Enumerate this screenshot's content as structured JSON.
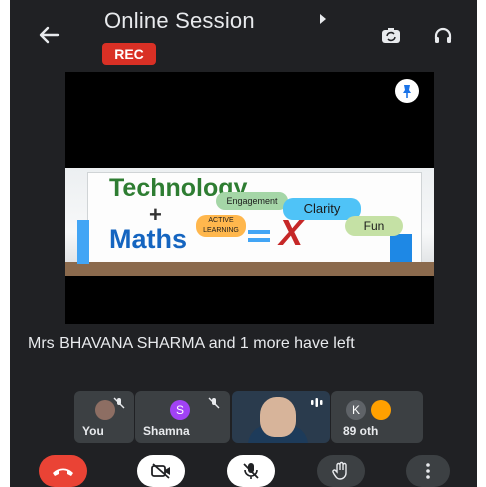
{
  "header": {
    "title": "Online Session",
    "rec_badge": "REC",
    "icons": [
      "back-arrow-icon",
      "switch-camera-icon",
      "headset-icon"
    ]
  },
  "slide": {
    "line1": "Technology",
    "plus": "+",
    "line2": "Maths",
    "engagement": "Engagement",
    "clarity": "Clarity",
    "active_learning": "ACTIVE LEARNING",
    "fun": "Fun"
  },
  "notification": "Mrs BHAVANA SHARMA and 1 more have left",
  "participants": [
    {
      "name": "You",
      "avatar": ""
    },
    {
      "name": "Shamna",
      "avatar": "S"
    },
    {
      "name": "",
      "avatar": ""
    },
    {
      "name": "89 oth",
      "avatar": "K"
    }
  ],
  "colors": {
    "background": "#202124",
    "rec": "#d93025",
    "hangup": "#ea4335",
    "tile": "#3c4043"
  }
}
